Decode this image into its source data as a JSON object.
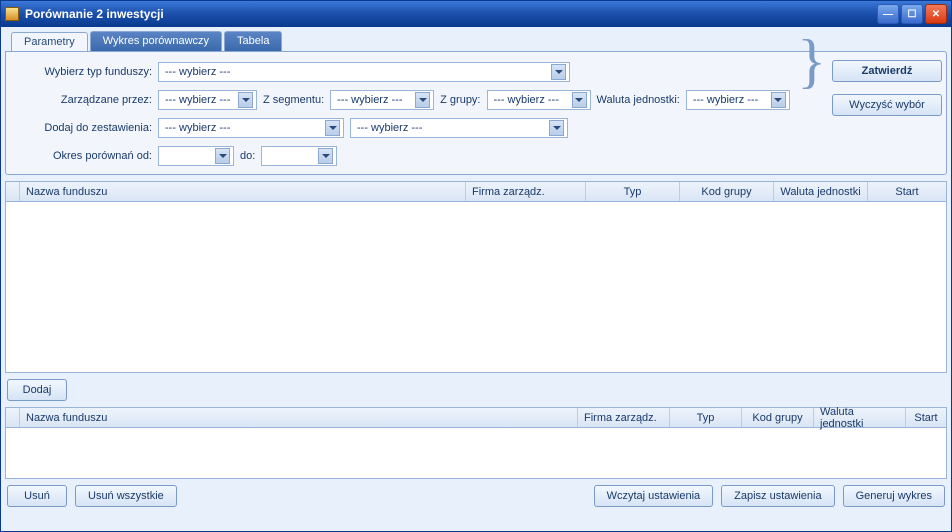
{
  "title": "Porównanie 2 inwestycji",
  "tabs": {
    "t1": "Parametry",
    "t2": "Wykres porównawczy",
    "t3": "Tabela"
  },
  "labels": {
    "fund_type": "Wybierz typ funduszy:",
    "managed_by": "Zarządzane przez:",
    "segment": "Z segmentu:",
    "group": "Z grupy:",
    "unit_currency": "Waluta jednostki:",
    "add_to_list": "Dodaj do zestawienia:",
    "compare_from": "Okres porównań od:",
    "to": "do:"
  },
  "placeholder": "--- wybierz ---",
  "buttons": {
    "confirm": "Zatwierdź",
    "clear": "Wyczyść wybór",
    "add": "Dodaj",
    "remove": "Usuń",
    "remove_all": "Usuń wszystkie",
    "load_settings": "Wczytaj ustawienia",
    "save_settings": "Zapisz ustawienia",
    "generate_chart": "Generuj wykres"
  },
  "columns": {
    "fund_name": "Nazwa funduszu",
    "mgmt": "Firma zarządz.",
    "type": "Typ",
    "group_code": "Kod grupy",
    "unit_currency": "Waluta jednostki",
    "start": "Start"
  }
}
